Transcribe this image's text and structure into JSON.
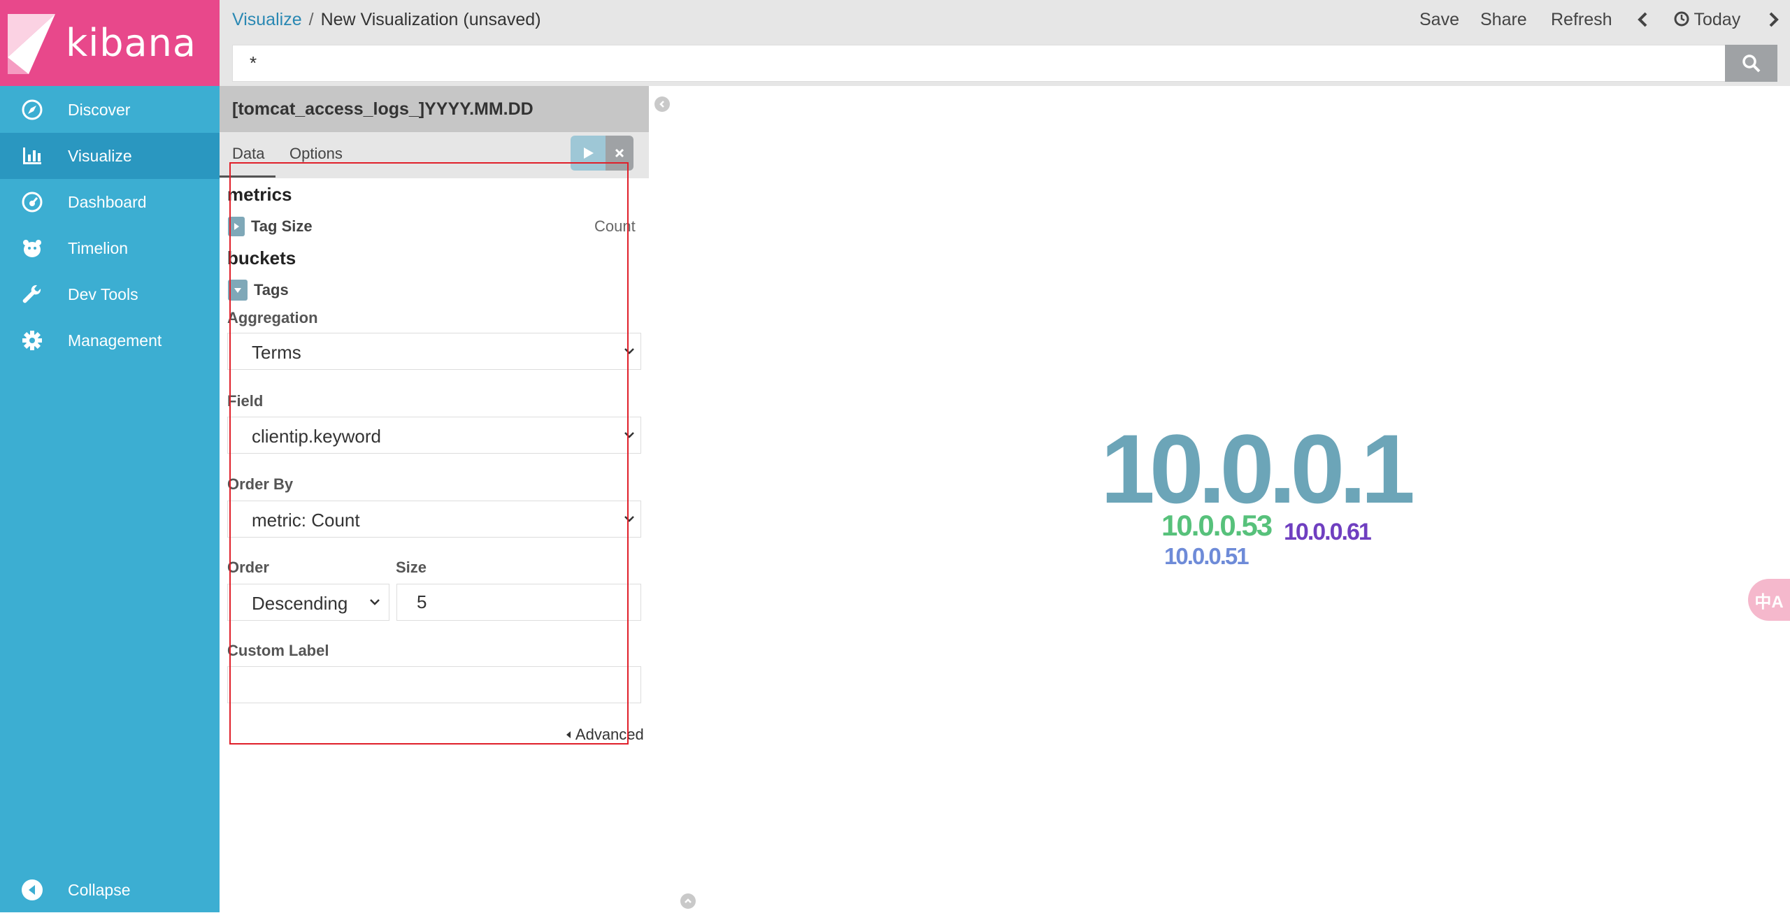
{
  "app": {
    "brand": "kibana",
    "brand_color": "#e8488b",
    "sidebar_color": "#3caed2"
  },
  "sidebar": {
    "items": [
      {
        "label": "Discover",
        "icon": "compass-icon"
      },
      {
        "label": "Visualize",
        "icon": "bar-chart-icon",
        "active": true
      },
      {
        "label": "Dashboard",
        "icon": "dashboard-gauge-icon"
      },
      {
        "label": "Timelion",
        "icon": "timelion-bear-icon"
      },
      {
        "label": "Dev Tools",
        "icon": "wrench-icon"
      },
      {
        "label": "Management",
        "icon": "gear-icon"
      }
    ],
    "collapse_label": "Collapse"
  },
  "header": {
    "breadcrumb_link": "Visualize",
    "breadcrumb_sep": "/",
    "breadcrumb_current": "New Visualization (unsaved)",
    "save": "Save",
    "share": "Share",
    "refresh": "Refresh",
    "time_range": "Today"
  },
  "search": {
    "query": "*"
  },
  "editor": {
    "index_pattern": "[tomcat_access_logs_]YYYY.MM.DD",
    "tabs": [
      "Data",
      "Options"
    ],
    "metrics_heading": "metrics",
    "metric_agg": {
      "title": "Tag Size",
      "value": "Count"
    },
    "buckets_heading": "buckets",
    "bucket_agg": {
      "title": "Tags"
    },
    "aggregation_label": "Aggregation",
    "aggregation_value": "Terms",
    "field_label": "Field",
    "field_value": "clientip.keyword",
    "order_by_label": "Order By",
    "order_by_value": "metric: Count",
    "order_label": "Order",
    "order_value": "Descending",
    "size_label": "Size",
    "size_value": "5",
    "custom_label_label": "Custom Label",
    "custom_label_value": "",
    "advanced_label": "Advanced"
  },
  "tag_cloud": {
    "tags": [
      {
        "text": "10.0.0.1",
        "color": "#6ca5b8"
      },
      {
        "text": "10.0.0.53",
        "color": "#57c17b"
      },
      {
        "text": "10.0.0.61",
        "color": "#6f3fc0"
      },
      {
        "text": "10.0.0.51",
        "color": "#6e8bd8"
      }
    ]
  },
  "widgets": {
    "translate": "中A"
  }
}
